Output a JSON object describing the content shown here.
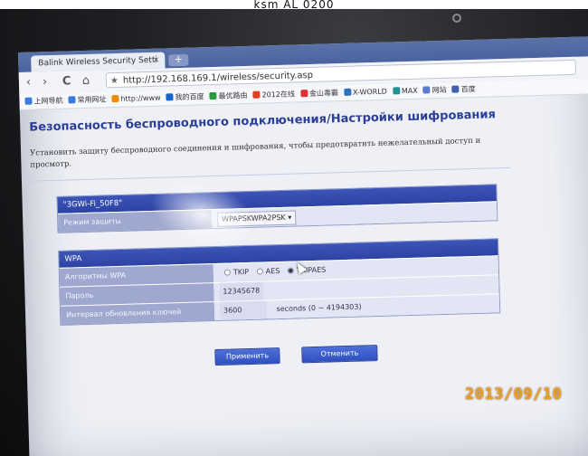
{
  "caption": "ksm AL 0200",
  "browser": {
    "tab_title": "Balink Wireless Security Setti",
    "tab_close": "×",
    "newtab_label": "+",
    "nav": {
      "back": "‹",
      "forward": "›",
      "reload": "C",
      "home": "⌂"
    },
    "url": "http://192.168.169.1/wireless/security.asp",
    "bookmarks": [
      {
        "label": "上网导航",
        "color": "#3b7be0"
      },
      {
        "label": "常用网址",
        "color": "#3b7be0"
      },
      {
        "label": "http://www",
        "color": "#f08a00"
      },
      {
        "label": "我的百度",
        "color": "#1b64c8"
      },
      {
        "label": "最优路由",
        "color": "#2b9a3c"
      },
      {
        "label": "2012在线",
        "color": "#e04020"
      },
      {
        "label": "金山毒霸",
        "color": "#e03030"
      },
      {
        "label": "X-WORLD",
        "color": "#3070c0"
      },
      {
        "label": "MAX",
        "color": "#209090"
      },
      {
        "label": "网站",
        "color": "#5a7ad0"
      },
      {
        "label": "百度",
        "color": "#4060b0"
      }
    ]
  },
  "page": {
    "title": "Безопасность беспроводного подключения/Настройки шифрования",
    "description": "Установить защиту беспроводного соединения и шифрования, чтобы предотвратить нежелательный доступ и просмотр."
  },
  "ssid_panel": {
    "header": "\"3GWi-Fi_50F8\"",
    "mode_label": "Режим защиты",
    "mode_value": "WPAPSKWPA2PSK",
    "mode_caret": "▾"
  },
  "wpa_panel": {
    "header": "WPA",
    "algo_label": "Алгоритмы WPA",
    "algo_options": [
      "TKIP",
      "AES",
      "TKIPAES"
    ],
    "algo_selected": "TKIPAES",
    "password_label": "Пароль",
    "password_value": "12345678",
    "interval_label": "Интервал обновления ключей",
    "interval_value": "3600",
    "interval_unit": "seconds  (0 ~ 4194303)"
  },
  "buttons": {
    "apply": "Применить",
    "cancel": "Отменить"
  },
  "photo_date_stamp": "2013/09/10"
}
